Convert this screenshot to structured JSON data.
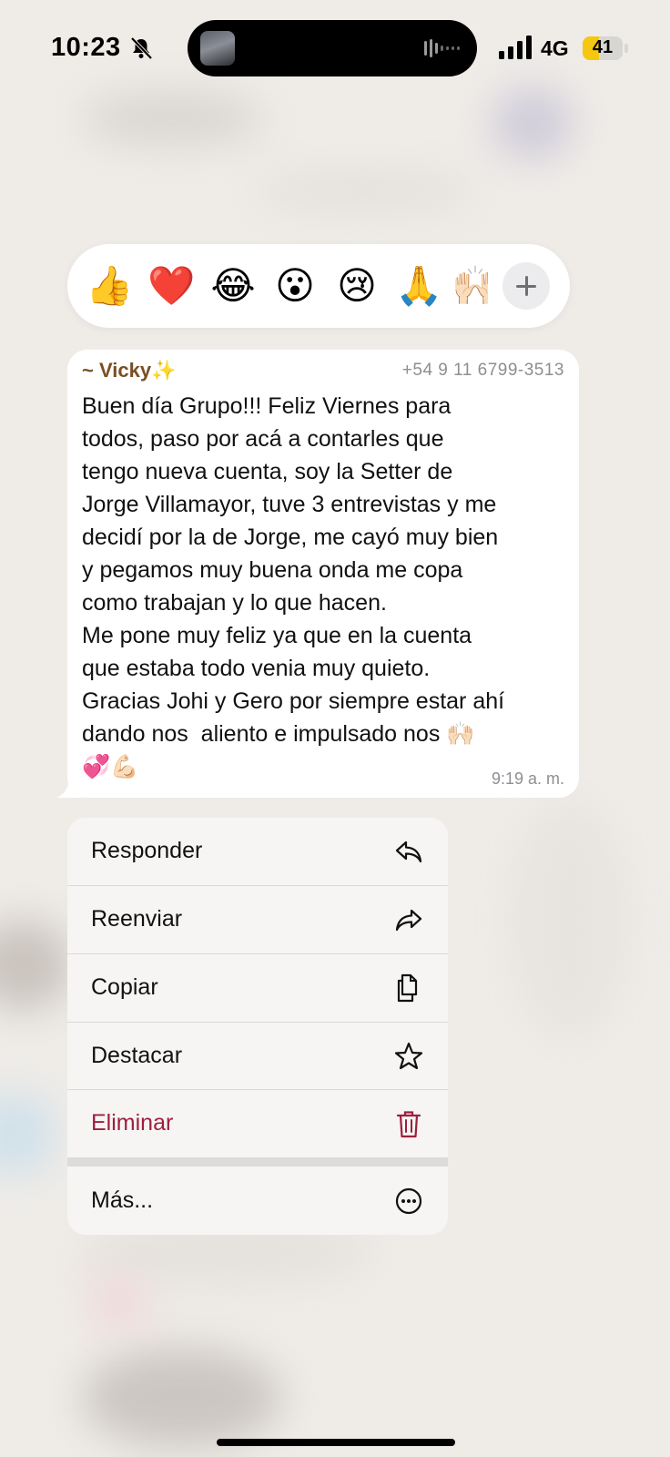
{
  "status_bar": {
    "time": "10:23",
    "network": "4G",
    "battery": "41",
    "battery_level": 0.41,
    "silent_icon": "bell-slash-icon",
    "signal_icon": "cellular-signal-icon"
  },
  "reactions": {
    "items": [
      {
        "name": "thumbs-up",
        "glyph": "👍"
      },
      {
        "name": "red-heart",
        "glyph": "❤️"
      },
      {
        "name": "laughing-tears",
        "glyph": "😂"
      },
      {
        "name": "surprised-face",
        "glyph": "😮"
      },
      {
        "name": "sad-face",
        "glyph": "😢"
      },
      {
        "name": "folded-hands",
        "glyph": "🙏"
      },
      {
        "name": "raising-hands",
        "glyph": "🙌🏻"
      }
    ],
    "add_icon": "plus-icon"
  },
  "message": {
    "sender": "~ Vicky",
    "sender_emoji": "✨",
    "phone": "+54 9 11 6799-3513",
    "text": "Buen día Grupo!!! Feliz Viernes para\ntodos, paso por acá a contarles que\ntengo nueva cuenta, soy la Setter de\nJorge Villamayor, tuve 3 entrevistas y me\ndecidí por la de Jorge, me cayó muy bien\ny pegamos muy buena onda me copa\ncomo trabajan y lo que hacen.\nMe pone muy feliz ya que en la cuenta\nque estaba todo venia muy quieto.\nGracias Johi y Gero por siempre estar ahí\ndando nos  aliento e impulsado nos 🙌🏻\n💞💪🏻",
    "time": "9:19 a. m."
  },
  "menu": {
    "items": [
      {
        "label": "Responder",
        "icon": "reply-icon"
      },
      {
        "label": "Reenviar",
        "icon": "forward-icon"
      },
      {
        "label": "Copiar",
        "icon": "copy-icon"
      },
      {
        "label": "Destacar",
        "icon": "star-icon"
      },
      {
        "label": "Eliminar",
        "icon": "trash-icon",
        "destructive": true
      },
      {
        "label": "Más...",
        "icon": "more-icon"
      }
    ]
  },
  "colors": {
    "background": "#efece8",
    "sender": "#7a4f23",
    "destructive": "#9e1f3e",
    "battery_fill": "#f5c711"
  }
}
